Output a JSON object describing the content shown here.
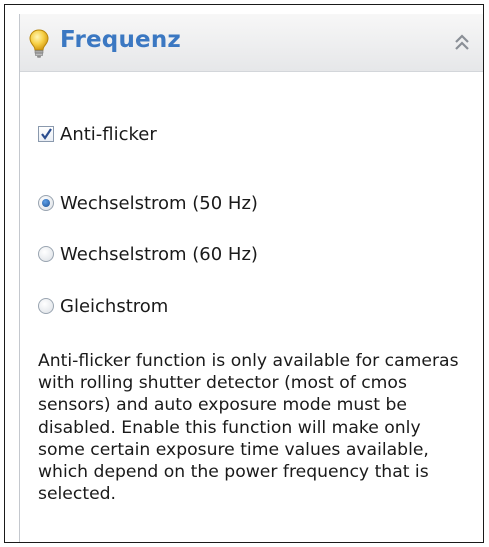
{
  "panel": {
    "title": "Frequenz",
    "icons": {
      "header": "lightbulb-icon",
      "collapse": "double-chevron-up-icon"
    },
    "anti_flicker": {
      "label": "Anti-flicker",
      "checked": true
    },
    "frequency_options": [
      {
        "label": "Wechselstrom (50 Hz)",
        "selected": true
      },
      {
        "label": "Wechselstrom (60 Hz)",
        "selected": false
      },
      {
        "label": "Gleichstrom",
        "selected": false
      }
    ],
    "description": "Anti-flicker function is only available for cameras with rolling shutter detector (most of cmos sensors) and auto exposure mode must be disabled. Enable this function will make only some certain exposure time values available, which depend on the power frequency that is selected."
  },
  "colors": {
    "title": "#3b78c2",
    "header_bg": "#e6e7e9",
    "radio_dot": "#1b4f93"
  }
}
